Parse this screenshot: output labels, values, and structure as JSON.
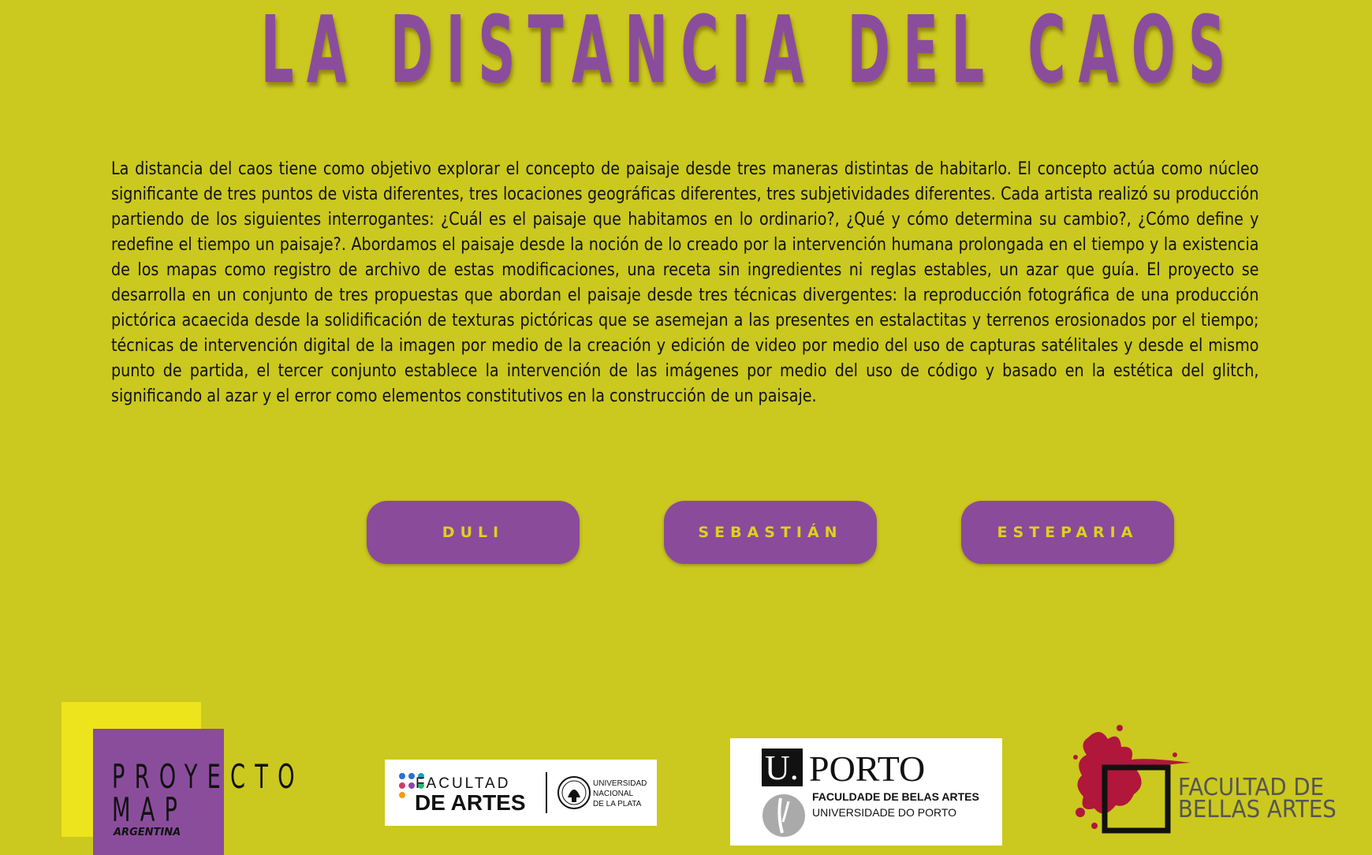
{
  "title": "LA DISTANCIA DEL CAOS",
  "description": "La distancia del caos tiene como objetivo explorar el concepto de paisaje desde tres maneras distintas de habitarlo. El concepto actúa como núcleo significante de tres puntos de vista diferentes, tres locaciones geográficas diferentes, tres subjetividades diferentes. Cada artista realizó su producción partiendo de los siguientes interrogantes: ¿Cuál es el paisaje que habitamos en lo ordinario?, ¿Qué y cómo determina su cambio?, ¿Cómo define y redefine el tiempo un paisaje?. Abordamos el paisaje desde la noción de lo creado por la intervención humana prolongada en el tiempo y la existencia de los mapas como registro de archivo de estas modificaciones, una receta sin ingredientes ni reglas estables, un azar que guía. El proyecto se desarrolla en un conjunto de tres propuestas que abordan el paisaje desde tres técnicas divergentes: la reproducción fotográfica de una producción pictórica acaecida desde la solidificación de texturas pictóricas que se asemejan a las presentes en estalactitas y terrenos erosionados por el tiempo; técnicas de intervención digital de la imagen por medio de la creación y edición de video por medio del uso de capturas satélitales y desde el mismo punto de partida, el tercer conjunto establece la intervención de las imágenes por medio del uso de código y basado en la estética del glitch, significando al azar y el error como elementos constitutivos en la construcción de un paisaje.",
  "artists": [
    {
      "label": "DULI"
    },
    {
      "label": "SEBASTIÁN"
    },
    {
      "label": "ESTEPARIA"
    }
  ],
  "logos": {
    "proyecto_map": {
      "line1": "PROYECTO",
      "line2": "MAP",
      "line3": "ARGENTINA"
    },
    "facultad_artes": {
      "line1": "FACULTAD",
      "line2": "DE ARTES",
      "uni1": "UNIVERSIDAD",
      "uni2": "NACIONAL",
      "uni3": "DE LA PLATA"
    },
    "uporto": {
      "u": "U.",
      "porto": "PORTO",
      "faculty": "FACULDADE DE BELAS ARTES",
      "university": "UNIVERSIDADE DO PORTO"
    },
    "bellas_artes": {
      "line1": "FACULTAD DE",
      "line2": "BELLAS ARTES"
    }
  },
  "colors": {
    "background": "#cbc81f",
    "accent_purple": "#8a4b9b",
    "button_text": "#ddd21c",
    "splash_red": "#b0173a"
  }
}
